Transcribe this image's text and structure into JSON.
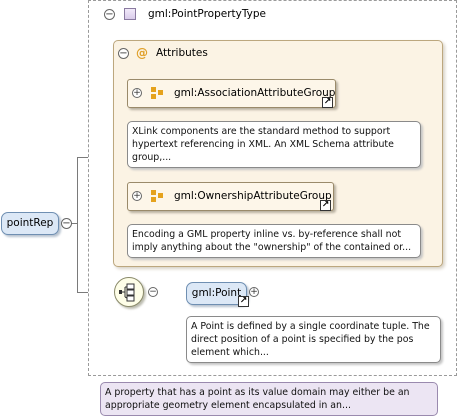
{
  "root_element": {
    "name": "pointRep"
  },
  "type": {
    "name": "gml:PointPropertyType",
    "documentation": "A property that has a point as its value domain may either be an appropriate geometry element encapsulated in an..."
  },
  "attributes": {
    "title": "Attributes",
    "groups": [
      {
        "name": "gml:AssociationAttributeGroup",
        "documentation": "XLink components are the standard method to support hypertext referencing in XML. An XML Schema attribute group,..."
      },
      {
        "name": "gml:OwnershipAttributeGroup",
        "documentation": "Encoding a GML property inline vs. by-reference shall not imply anything about the \"ownership\" of the contained or..."
      }
    ]
  },
  "child_element": {
    "name": "gml:Point",
    "documentation": "A Point is defined by a single coordinate tuple. The direct position of a point is specified by the pos element which..."
  },
  "icons": {
    "collapse": "minus-toggle-icon",
    "expand": "plus-toggle-icon",
    "complex_type": "complex-type-icon",
    "attribute": "at-attribute-icon",
    "attribute_group": "attribute-group-icon",
    "reference": "reference-arrow-icon",
    "sequence": "sequence-compositor-icon"
  },
  "glyphs": {
    "minus": "−",
    "plus": "+",
    "at": "@",
    "ref": "↗"
  },
  "colors": {
    "element_fill": "#dce8f6",
    "attributes_fill": "#fbf3e4",
    "documentation_lilac": "#ece5f3",
    "group_icon": "#e5a21d"
  }
}
